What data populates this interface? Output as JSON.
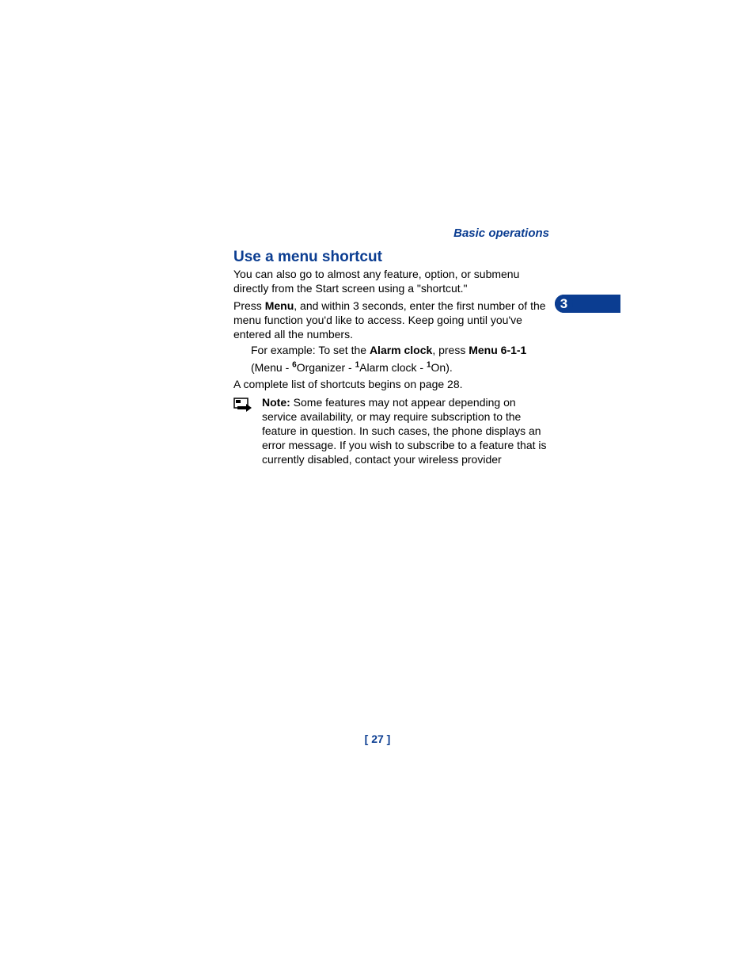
{
  "header": {
    "section_label": "Basic operations"
  },
  "chapter": {
    "number": "3"
  },
  "heading": "Use a menu shortcut",
  "p1": "You can also go to almost any feature, option, or submenu directly from the Start screen using a \"shortcut.\"",
  "p2": {
    "t1": "Press ",
    "b1": "Menu",
    "t2": ", and within 3 seconds, enter the first number of the menu function you'd like to access. Keep going until you've entered all the numbers."
  },
  "example": {
    "t1": "For example: To set the ",
    "b1": "Alarm clock",
    "t2": ", press ",
    "b2": "Menu 6-1-1",
    "l2a": "(Menu - ",
    "s1": "6",
    "l2b": "Organizer - ",
    "s2": "1",
    "l2c": "Alarm clock - ",
    "s3": "1",
    "l2d": "On)."
  },
  "p3": "A complete list of shortcuts begins on page 28.",
  "note": {
    "label": "Note:",
    "text": " Some features may not appear depending on service availability, or may require subscription to the feature in question. In such cases, the phone displays an error message. If you wish to subscribe to a feature that is currently disabled, contact your wireless provider"
  },
  "page_number": "[ 27 ]"
}
